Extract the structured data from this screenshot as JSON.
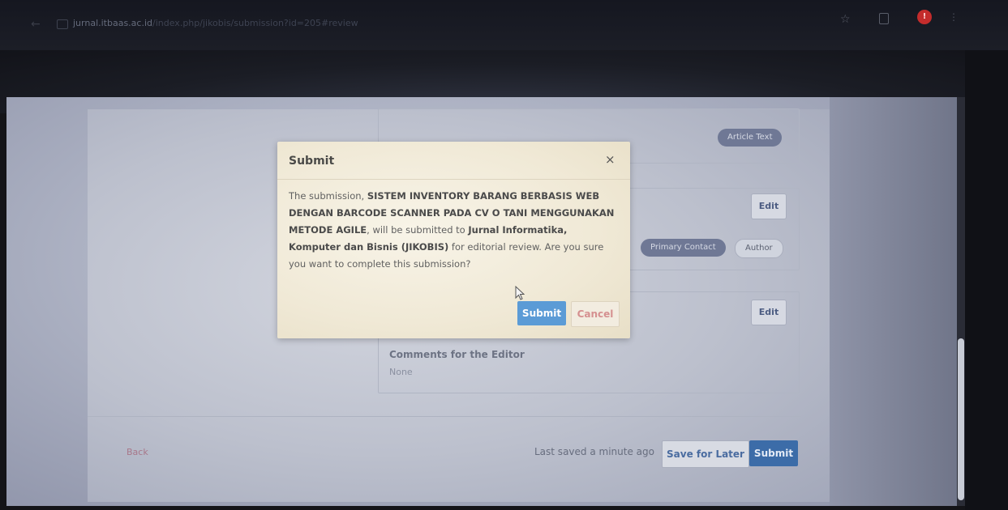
{
  "browser": {
    "url_host": "jurnal.itbaas.ac.id",
    "url_path": "/index.php/jikobis/submission?id=205#review"
  },
  "page": {
    "article_text_pill": "Article Text",
    "primary_contact_pill": "Primary Contact",
    "author_pill": "Author",
    "edit_label": "Edit",
    "comments_label": "Comments for the Editor",
    "comments_value": "None",
    "back_label": "Back",
    "last_saved": "Last saved a minute ago",
    "save_for_later": "Save for Later",
    "submit_label": "Submit"
  },
  "modal": {
    "title": "Submit",
    "close_glyph": "×",
    "body": {
      "intro": "The submission, ",
      "title": "SISTEM INVENTORY BARANG BERBASIS WEB DENGAN BARCODE SCANNER  PADA CV O TANI  MENGGUNAKAN METODE AGILE",
      "mid": ", will be submitted to ",
      "journal": "Jurnal Informatika, Komputer dan Bisnis (JIKOBIS)",
      "outro": " for editorial review. Are you sure you want to complete this submission?"
    },
    "submit_label": "Submit",
    "cancel_label": "Cancel"
  },
  "colors": {
    "primary": "#5b9bd6",
    "cancel_text": "#d59090",
    "modal_bg": "#f4eedd"
  }
}
